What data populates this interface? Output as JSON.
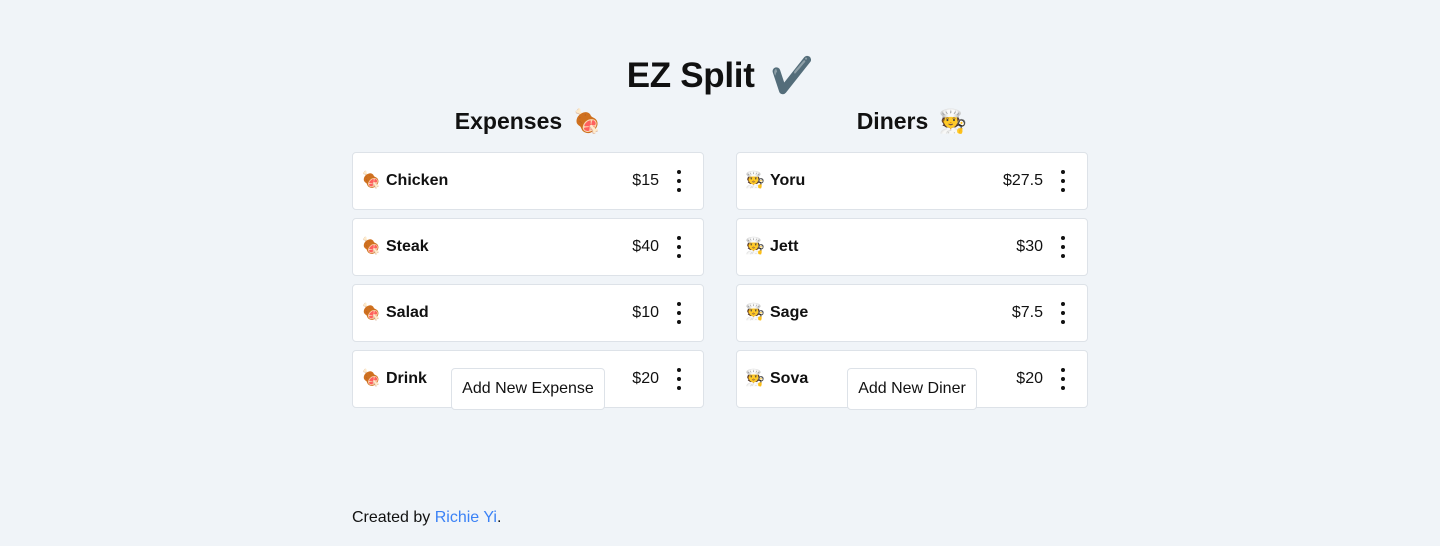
{
  "app": {
    "title": "EZ Split",
    "title_icon": "✔️"
  },
  "expenses": {
    "heading": "Expenses",
    "heading_icon": "🍖",
    "items": [
      {
        "icon": "🍖",
        "name": "Chicken",
        "amount": "$15"
      },
      {
        "icon": "🍖",
        "name": "Steak",
        "amount": "$40"
      },
      {
        "icon": "🍖",
        "name": "Salad",
        "amount": "$10"
      },
      {
        "icon": "🍖",
        "name": "Drink",
        "amount": "$20"
      }
    ],
    "add_label": "Add New Expense"
  },
  "diners": {
    "heading": "Diners",
    "heading_icon": "🧑‍🍳",
    "items": [
      {
        "icon": "🧑‍🍳",
        "name": "Yoru",
        "amount": "$27.5"
      },
      {
        "icon": "🧑‍🍳",
        "name": "Jett",
        "amount": "$30"
      },
      {
        "icon": "🧑‍🍳",
        "name": "Sage",
        "amount": "$7.5"
      },
      {
        "icon": "🧑‍🍳",
        "name": "Sova",
        "amount": "$20"
      }
    ],
    "add_label": "Add New Diner"
  },
  "footer": {
    "prefix": "Created by ",
    "author": "Richie Yi",
    "suffix": "."
  },
  "colors": {
    "background": "#f0f4f8",
    "card": "#ffffff",
    "border": "#dde2e8",
    "link": "#3b82f6"
  }
}
